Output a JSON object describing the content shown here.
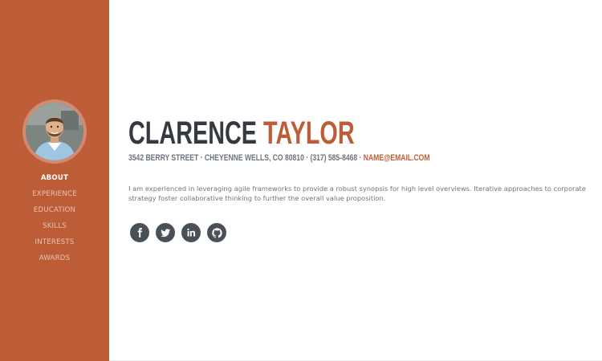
{
  "sidebar": {
    "nav": [
      {
        "label": "ABOUT",
        "active": true
      },
      {
        "label": "EXPERIENCE"
      },
      {
        "label": "EDUCATION"
      },
      {
        "label": "SKILLS"
      },
      {
        "label": "INTERESTS"
      },
      {
        "label": "AWARDS"
      }
    ]
  },
  "profile": {
    "first_name": "CLARENCE",
    "last_name": "TAYLOR",
    "address": "3542 BERRY STREET · CHEYENNE WELLS, CO 80810 · (317) 585-8468 · ",
    "email": "NAME@EMAIL.COM",
    "bio": "I am experienced in leveraging agile frameworks to provide a robust synopsis for high level overviews. Iterative approaches to corporate strategy foster collaborative thinking to further the overall value proposition."
  },
  "social": [
    {
      "icon": "facebook-icon"
    },
    {
      "icon": "twitter-icon"
    },
    {
      "icon": "linkedin-icon"
    },
    {
      "icon": "github-icon"
    }
  ],
  "colors": {
    "primary": "#bd5d38",
    "dark": "#343a40",
    "muted": "#6c757d",
    "icon_bg": "#495057"
  }
}
